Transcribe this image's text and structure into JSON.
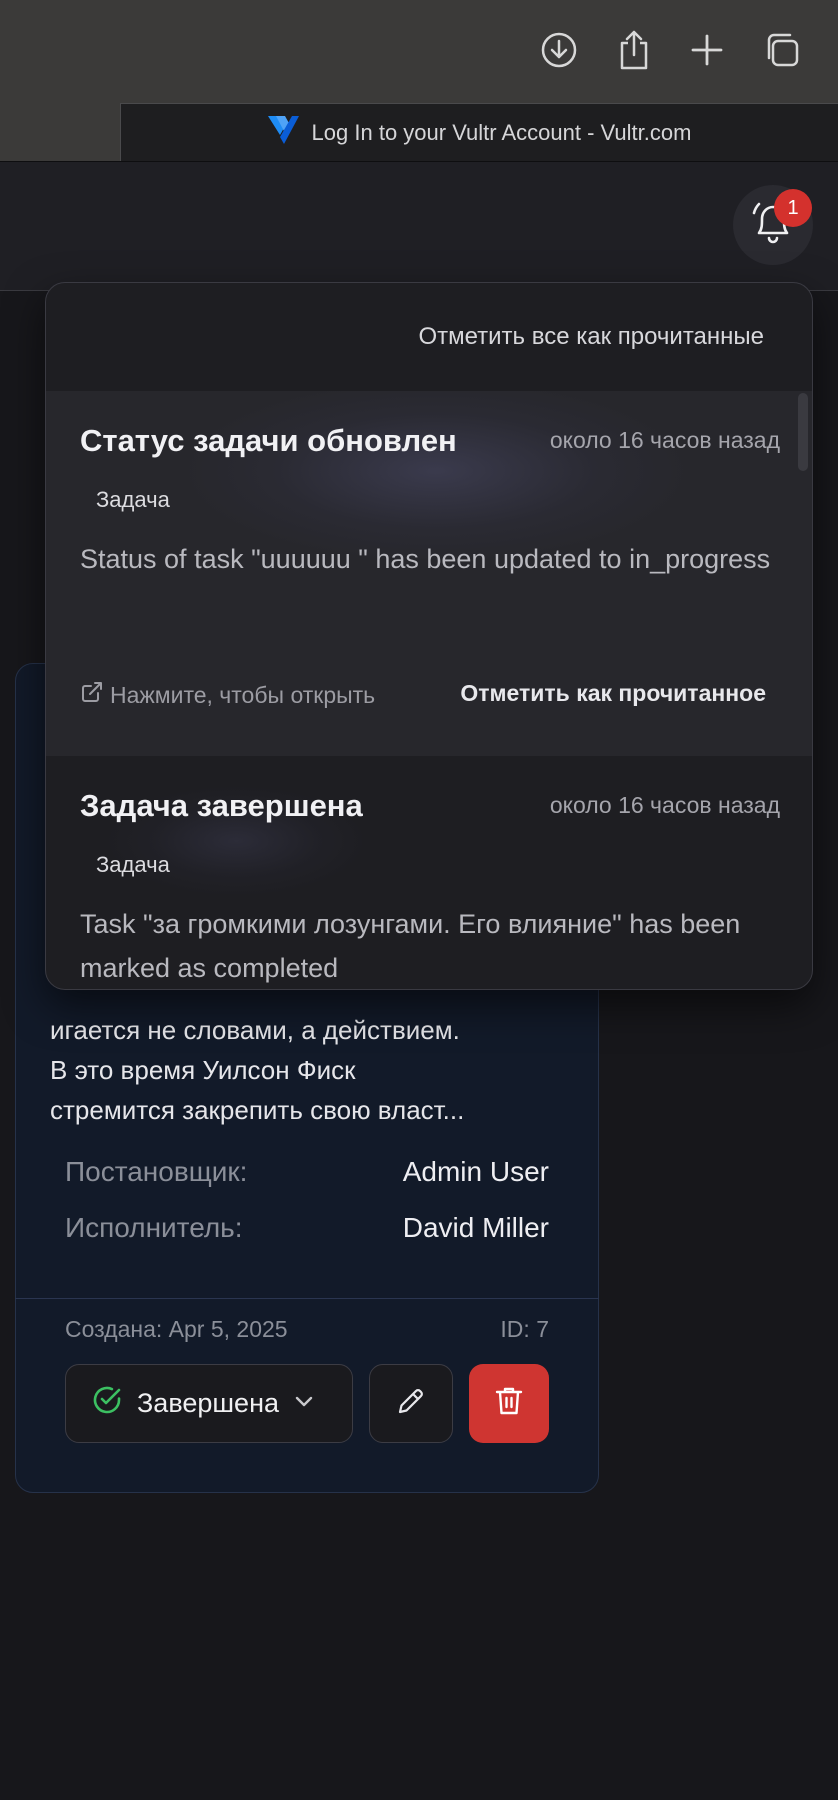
{
  "browser": {
    "tab_title": "Log In to your Vultr Account - Vultr.com",
    "toolbar_icons": [
      "download-icon",
      "share-icon",
      "plus-icon",
      "tabs-icon"
    ]
  },
  "header": {
    "notification_count": "1"
  },
  "notifications": {
    "mark_all_label": "Отметить все как прочитанные",
    "items": [
      {
        "title": "Статус задачи обновлен",
        "time": "около 16 часов назад",
        "tag": "Задача",
        "body": "Status of task \"uuuuuu \" has been updated to in_progress",
        "open_label": "Нажмите, чтобы открыть",
        "mark_read_label": "Отметить как прочитанное"
      },
      {
        "title": "Задача завершена",
        "time": "около 16 часов назад",
        "tag": "Задача",
        "body": "Task \"за громкими лозунгами. Его влияние\" has been marked as completed"
      }
    ]
  },
  "task_card": {
    "description": "игается не словами, а действием.\nВ это время Уилсон Фиск\nстремится закрепить свою власт...",
    "assigner_label": "Постановщик:",
    "assigner_value": "Admin User",
    "assignee_label": "Исполнитель:",
    "assignee_value": "David Miller",
    "created": "Создана: Apr 5, 2025",
    "id": "ID: 7",
    "status": "Завершена",
    "colors": {
      "card_bg": "#121a29",
      "delete": "#cf3531",
      "status_ok": "#3cc062"
    }
  }
}
